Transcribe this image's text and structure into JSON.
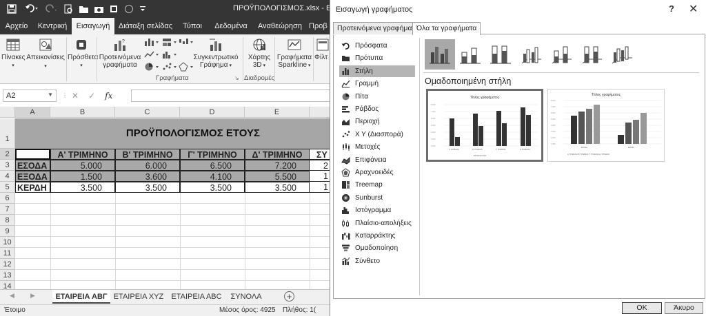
{
  "excel": {
    "title": "ΠΡΟΫΠΟΛΟΓΙΣΜΟΣ.xlsx - Excel",
    "ribbon_tabs": [
      "Αρχείο",
      "Κεντρική",
      "Εισαγωγή",
      "Διάταξη σελίδας",
      "Τύποι",
      "Δεδομένα",
      "Αναθεώρηση",
      "Προβ"
    ],
    "active_tab": "Εισαγωγή",
    "ribbon": {
      "tables_label": "Πίνακες",
      "illustrations_label": "Απεικονίσεις",
      "addins_label": "Πρόσθετα",
      "recommended_charts_line1": "Προτεινόμενα",
      "recommended_charts_line2": "γραφήματα",
      "pivotchart_line1": "Συγκεντρωτικό",
      "pivotchart_line2": "Γράφημα",
      "map3d_line1": "Χάρτης",
      "map3d_line2": "3D",
      "sparklines_line1": "Γραφήματα",
      "sparklines_line2": "Sparkline",
      "filters_label": "Φίλτ",
      "group_charts": "Γραφήματα",
      "group_tours": "Διαδρομές"
    },
    "name_box": "A2",
    "fx_label": "fx",
    "columns": [
      "A",
      "B",
      "C",
      "D",
      "E"
    ],
    "rows": [
      "1",
      "2",
      "3",
      "4",
      "5",
      "6",
      "7",
      "8",
      "9",
      "10",
      "11",
      "12",
      "13",
      "14"
    ],
    "sheet_title": "ΠΡΟΫΠΟΛΟΓΙΣΜΟΣ ΕΤΟΥΣ",
    "table": {
      "headers": [
        "Α' ΤΡΙΜΗΝΟ",
        "Β' ΤΡΙΜΗΝΟ",
        "Γ' ΤΡΙΜΗΝΟ",
        "Δ' ΤΡΙΜΗΝΟ",
        "ΣΥ"
      ],
      "rows": [
        {
          "label": "ΕΣΟΔΑ",
          "values": [
            "5.000",
            "6.000",
            "6.500",
            "7.200",
            "2"
          ]
        },
        {
          "label": "ΕΞΟΔΑ",
          "values": [
            "1.500",
            "3.600",
            "4.100",
            "5.500",
            "1"
          ]
        },
        {
          "label": "ΚΕΡΔΗ",
          "values": [
            "3.500",
            "3.500",
            "3.500",
            "3.500",
            "1"
          ]
        }
      ]
    },
    "sheet_tabs": [
      "ΕΤΑΙΡΕΙΑ ΑΒΓ",
      "ΕΤΑΙΡΕΙΑ ΧΥΖ",
      "ΕΤΑΙΡΕΙΑ ΑΒC",
      "ΣΥΝΟΛΑ"
    ],
    "active_sheet": "ΕΤΑΙΡΕΙΑ ΑΒΓ",
    "status": {
      "ready": "Έτοιμο",
      "average": "Μέσος όρος: 4925",
      "count": "Πλήθος: 1("
    }
  },
  "dialog": {
    "title": "Εισαγωγή γραφήματος",
    "help": "?",
    "close": "✕",
    "tabs": [
      "Προτεινόμενα γραφήματα",
      "Όλα τα γραφήματα"
    ],
    "active_tab": "Όλα τα γραφήματα",
    "categories": [
      {
        "label": "Πρόσφατα",
        "icon": "undo-icon"
      },
      {
        "label": "Πρότυπα",
        "icon": "folder-icon"
      },
      {
        "label": "Στήλη",
        "icon": "column-chart-icon"
      },
      {
        "label": "Γραμμή",
        "icon": "line-chart-icon"
      },
      {
        "label": "Πίτα",
        "icon": "pie-chart-icon"
      },
      {
        "label": "Ράβδος",
        "icon": "bar-chart-icon"
      },
      {
        "label": "Περιοχή",
        "icon": "area-chart-icon"
      },
      {
        "label": "Χ Υ (Διασπορά)",
        "icon": "scatter-chart-icon"
      },
      {
        "label": "Μετοχές",
        "icon": "stock-chart-icon"
      },
      {
        "label": "Επιφάνεια",
        "icon": "surface-chart-icon"
      },
      {
        "label": "Αραχνοειδές",
        "icon": "radar-chart-icon"
      },
      {
        "label": "Treemap",
        "icon": "treemap-icon"
      },
      {
        "label": "Sunburst",
        "icon": "sunburst-icon"
      },
      {
        "label": "Ιστόγραμμα",
        "icon": "histogram-icon"
      },
      {
        "label": "Πλαίσιο-απολήξεις",
        "icon": "box-whisker-icon"
      },
      {
        "label": "Καταρράκτης",
        "icon": "waterfall-icon"
      },
      {
        "label": "Ομαδοποίηση",
        "icon": "funnel-icon"
      },
      {
        "label": "Σύνθετο",
        "icon": "combo-chart-icon"
      }
    ],
    "selected_category": "Στήλη",
    "subtype_name": "Ομαδοποιημένη στήλη",
    "preview_title": "Τίτλος γραφήματος",
    "ok_label": "OK",
    "cancel_label": "Άκυρο"
  },
  "colors": {
    "title_bar": "#353535",
    "ribbon_bg": "#f3f3f3",
    "header_band": "#a9a9a9",
    "selection": "#b5b5b5"
  }
}
